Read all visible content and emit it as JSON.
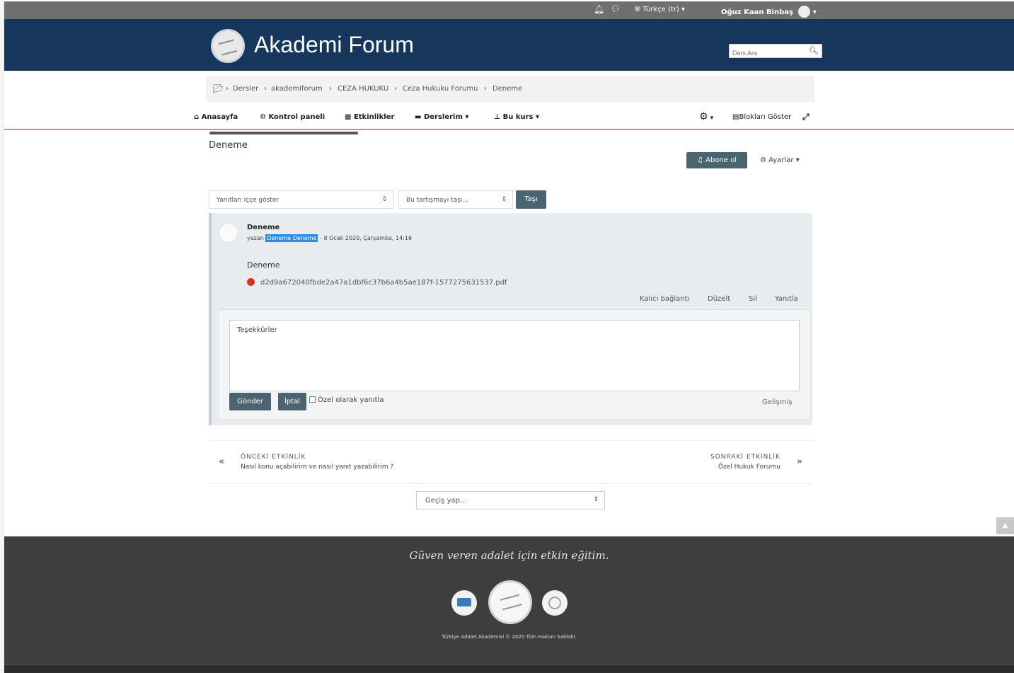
{
  "topbar": {
    "language": "Türkçe (tr)",
    "user_name": "Oğuz Kaan Binbaş"
  },
  "header": {
    "site_name": "Akademi Forum",
    "search_placeholder": "Ders Ara"
  },
  "breadcrumb": {
    "items": [
      "Dersler",
      "akademiforum",
      "CEZA HUKUKU",
      "Ceza Hukuku Forumu",
      "Deneme"
    ]
  },
  "nav": {
    "items": [
      "Anasayfa",
      "Kontrol paneli",
      "Etkinlikler",
      "Derslerim",
      "Bu kurs"
    ],
    "blocks_button": "Blokları Göster"
  },
  "discussion": {
    "title": "Deneme",
    "subscribe_button": "Abone ol",
    "settings_menu": "Ayarlar",
    "display_mode_select": "Yanıtları iççe göster",
    "move_select": "Bu tartışmayı taşı...",
    "move_button": "Taşı"
  },
  "post": {
    "subject": "Deneme",
    "by_prefix": "yazan",
    "author": "Deneme Deneme",
    "date": "- 8 Ocak 2020, Çarşamba, 14:16",
    "body": "Deneme",
    "attachment": "d2d9a672040fbde2a47a1dbf6c37b6a4b5ae187f-1577275631537.pdf",
    "actions": [
      "Kalıcı bağlantı",
      "Düzelt",
      "Sil",
      "Yanıtla"
    ]
  },
  "reply": {
    "text": "Teşekkürler",
    "send_button": "Gönder",
    "cancel_button": "İptal",
    "private_reply_label": "Özel olarak yanıtla",
    "advanced_link": "Gelişmiş"
  },
  "activity_nav": {
    "prev_label": "ÖNCEKİ ETKİNLİK",
    "prev_title": "Nasıl konu açabilirim ve nasıl yanıt yazabilirim ?",
    "next_label": "SONRAKİ ETKİNLİK",
    "next_title": "Özel Hukuk Forumu",
    "jump_select": "Geçiş yap..."
  },
  "footer": {
    "slogan": "Güven veren adalet için etkin eğitim.",
    "copyright": "Türkiye Adalet Akademisi © 2020 Tüm Hakları Saklıdır."
  },
  "colors": {
    "header_bg": "#16365c",
    "button_bg": "#4a6470",
    "footer_bg": "#3e3e3e",
    "nav_underline": "#c8a03c"
  }
}
